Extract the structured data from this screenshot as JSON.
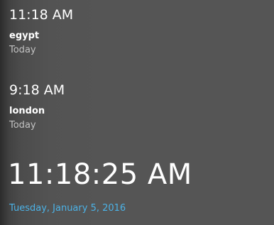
{
  "clocks": [
    {
      "time": "11:18 AM",
      "city": "egypt",
      "day": "Today"
    },
    {
      "time": "9:18 AM",
      "city": "london",
      "day": "Today"
    }
  ],
  "current": {
    "time": "11:18:25 AM",
    "date": "Tuesday, January 5, 2016"
  },
  "colors": {
    "background": "#555555",
    "date_accent": "#4cb2e6",
    "secondary_text": "#c2c2c2"
  }
}
